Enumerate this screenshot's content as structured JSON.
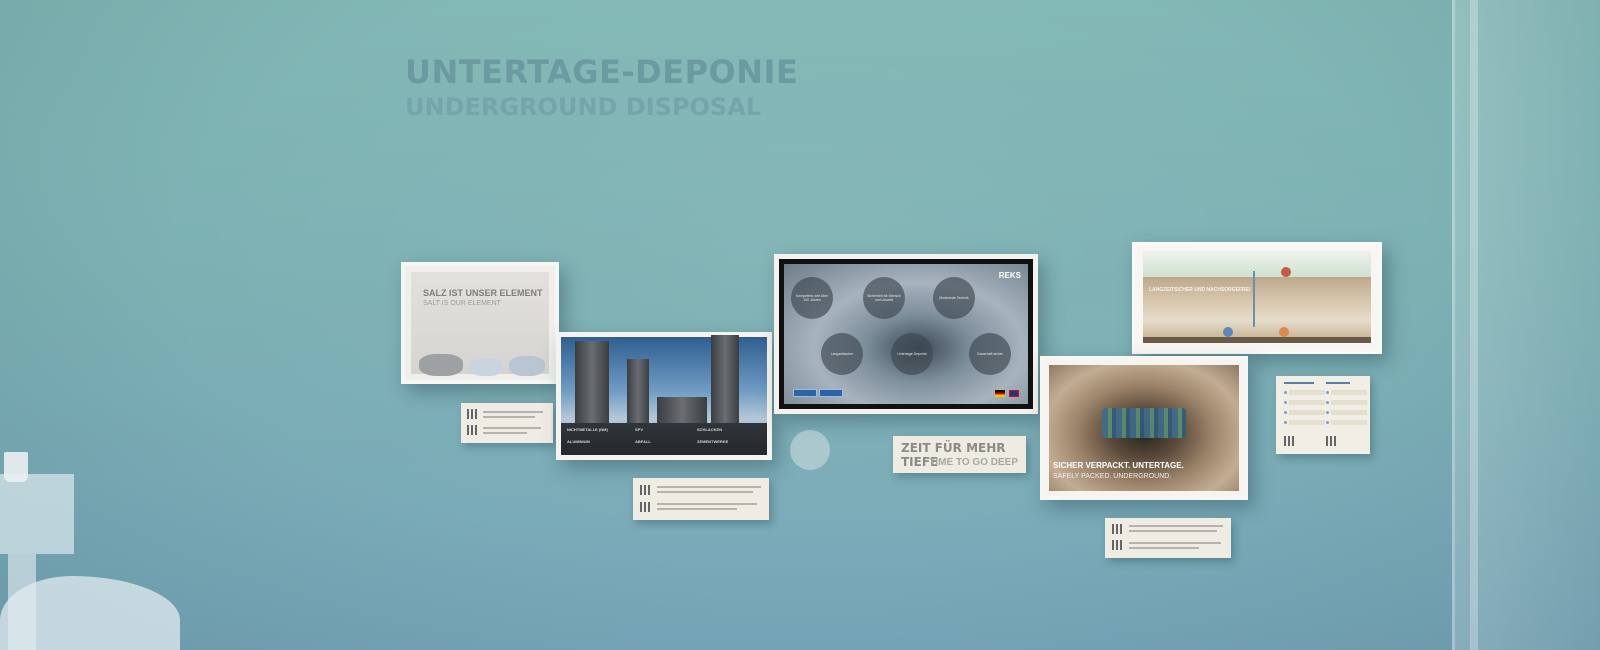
{
  "headline": {
    "line1": "UNTERTAGE-DEPONIE",
    "line2": "UNDERGROUND DISPOSAL"
  },
  "salt_panel": {
    "title": "SALZ IST UNSER ELEMENT",
    "subtitle": "SALT IS OUR ELEMENT"
  },
  "industry_panel": {
    "captions": [
      "NICHTMETALLE (NM)",
      "SPV",
      "SCHLACKEN",
      "ALUMINIUM",
      "ABFALL",
      "ZEMENTWERKE"
    ]
  },
  "screen": {
    "brand": "REKS",
    "bubbles": [
      "Kompetenz seit über 100 Jahren",
      "Sicherheit für Mensch und Umwelt",
      "Modernste Technik",
      "Langzeitsicher",
      "Untertage Deponie",
      "Dauerhaft sicher"
    ],
    "buttons": [
      "DEUTSCH",
      "ENGLISH"
    ]
  },
  "zeit_card": {
    "line1": "ZEIT FÜR MEHR TIEFE",
    "line2": "TIME TO GO DEEP"
  },
  "diagram_panel": {
    "title": "LANGZEITSICHER UND NACHSORGEFREI"
  },
  "sicher_panel": {
    "line1": "SICHER VERPACKT. UNTERTAGE.",
    "line2": "SAFELY PACKED. UNDERGROUND."
  },
  "colors": {
    "wall": "#82b8b6",
    "headline": "#6b9aa1",
    "card": "#efece4"
  }
}
